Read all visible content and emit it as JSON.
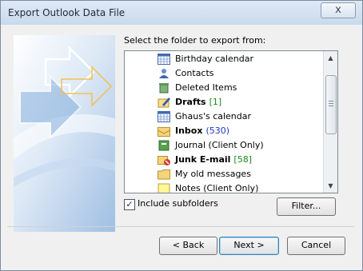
{
  "window": {
    "title": "Export Outlook Data File",
    "close_glyph": "x"
  },
  "prompt": "Select the folder to export from:",
  "folders": [
    {
      "name": "Birthday calendar",
      "icon": "calendar-icon",
      "bold": false,
      "count": ""
    },
    {
      "name": "Contacts",
      "icon": "contacts-icon",
      "bold": false,
      "count": ""
    },
    {
      "name": "Deleted Items",
      "icon": "trash-icon",
      "bold": false,
      "count": ""
    },
    {
      "name": "Drafts",
      "icon": "drafts-icon",
      "bold": true,
      "count": "[1]"
    },
    {
      "name": "Ghaus's calendar",
      "icon": "calendar-icon",
      "bold": false,
      "count": ""
    },
    {
      "name": "Inbox",
      "icon": "inbox-icon",
      "bold": true,
      "count": "(530)"
    },
    {
      "name": "Journal (Client Only)",
      "icon": "journal-icon",
      "bold": false,
      "count": ""
    },
    {
      "name": "Junk E-mail",
      "icon": "junk-mail-icon",
      "bold": true,
      "count": "[58]"
    },
    {
      "name": "My old messages",
      "icon": "folder-icon",
      "bold": false,
      "count": ""
    },
    {
      "name": "Notes (Client Only)",
      "icon": "notes-icon",
      "bold": false,
      "count": ""
    }
  ],
  "include_subfolders": {
    "label": "Include subfolders",
    "checked": true,
    "check_glyph": "✓"
  },
  "buttons": {
    "filter": "Filter...",
    "back": "< Back",
    "next": "Next >",
    "cancel": "Cancel"
  },
  "colors": {
    "accent": "#3c7fb1",
    "count_blue": "#1a3bb8",
    "count_green": "#1b8a1b"
  }
}
